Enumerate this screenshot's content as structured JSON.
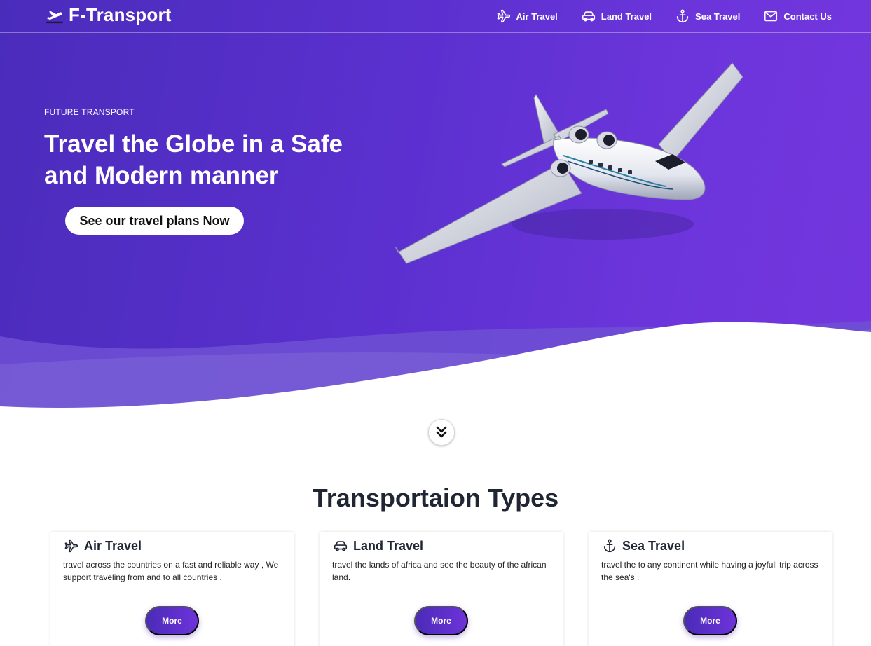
{
  "colors": {
    "hero_start": "#4a2cbb",
    "hero_end": "#7436de",
    "button_start": "#4b2bb8",
    "button_end": "#6d33d9",
    "heading_text": "#1f2533"
  },
  "navbar": {
    "brand": {
      "icon": "plane-departure-icon",
      "name": "F-Transport"
    },
    "links": [
      {
        "icon": "plane-icon",
        "label": "Air Travel"
      },
      {
        "icon": "car-icon",
        "label": "Land Travel"
      },
      {
        "icon": "anchor-icon",
        "label": "Sea Travel"
      },
      {
        "icon": "envelope-icon",
        "label": "Contact Us"
      }
    ]
  },
  "hero": {
    "eyebrow": "FUTURE TRANSPORT",
    "headline": "Travel the Globe in a Safe and Modern manner",
    "cta_label": "See our travel plans Now",
    "image": "private-jet-image"
  },
  "scroll_down": {
    "icon": "double-chevron-down-icon"
  },
  "types_section": {
    "title": "Transportaion Types",
    "cards": [
      {
        "icon": "plane-icon",
        "title": "Air Travel",
        "text": "travel across the countries on a fast and reliable way , We support traveling from and to all countries .",
        "button": "More"
      },
      {
        "icon": "car-icon",
        "title": "Land Travel",
        "text": "travel the lands of africa and see the beauty of the african land.",
        "button": "More"
      },
      {
        "icon": "anchor-icon",
        "title": "Sea Travel",
        "text": "travel the to any continent while having a joyfull trip across the sea's .",
        "button": "More"
      }
    ]
  }
}
